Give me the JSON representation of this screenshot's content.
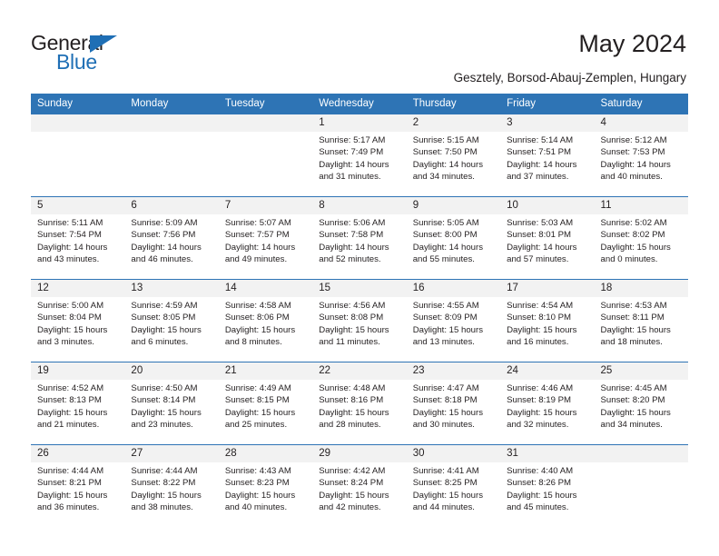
{
  "brand": {
    "name_part1": "General",
    "name_part2": "Blue",
    "accent_color": "#1f6fb5",
    "triangle_icon": "triangle-icon"
  },
  "header": {
    "title": "May 2024",
    "subtitle": "Gesztely, Borsod-Abauj-Zemplen, Hungary"
  },
  "calendar": {
    "header_bg": "#2e74b5",
    "daynum_bg": "#f2f2f2",
    "weekdays": [
      "Sunday",
      "Monday",
      "Tuesday",
      "Wednesday",
      "Thursday",
      "Friday",
      "Saturday"
    ],
    "weeks": [
      {
        "days": [
          {
            "num": "",
            "l1": "",
            "l2": "",
            "l3": "",
            "l4": ""
          },
          {
            "num": "",
            "l1": "",
            "l2": "",
            "l3": "",
            "l4": ""
          },
          {
            "num": "",
            "l1": "",
            "l2": "",
            "l3": "",
            "l4": ""
          },
          {
            "num": "1",
            "l1": "Sunrise: 5:17 AM",
            "l2": "Sunset: 7:49 PM",
            "l3": "Daylight: 14 hours",
            "l4": "and 31 minutes."
          },
          {
            "num": "2",
            "l1": "Sunrise: 5:15 AM",
            "l2": "Sunset: 7:50 PM",
            "l3": "Daylight: 14 hours",
            "l4": "and 34 minutes."
          },
          {
            "num": "3",
            "l1": "Sunrise: 5:14 AM",
            "l2": "Sunset: 7:51 PM",
            "l3": "Daylight: 14 hours",
            "l4": "and 37 minutes."
          },
          {
            "num": "4",
            "l1": "Sunrise: 5:12 AM",
            "l2": "Sunset: 7:53 PM",
            "l3": "Daylight: 14 hours",
            "l4": "and 40 minutes."
          }
        ]
      },
      {
        "days": [
          {
            "num": "5",
            "l1": "Sunrise: 5:11 AM",
            "l2": "Sunset: 7:54 PM",
            "l3": "Daylight: 14 hours",
            "l4": "and 43 minutes."
          },
          {
            "num": "6",
            "l1": "Sunrise: 5:09 AM",
            "l2": "Sunset: 7:56 PM",
            "l3": "Daylight: 14 hours",
            "l4": "and 46 minutes."
          },
          {
            "num": "7",
            "l1": "Sunrise: 5:07 AM",
            "l2": "Sunset: 7:57 PM",
            "l3": "Daylight: 14 hours",
            "l4": "and 49 minutes."
          },
          {
            "num": "8",
            "l1": "Sunrise: 5:06 AM",
            "l2": "Sunset: 7:58 PM",
            "l3": "Daylight: 14 hours",
            "l4": "and 52 minutes."
          },
          {
            "num": "9",
            "l1": "Sunrise: 5:05 AM",
            "l2": "Sunset: 8:00 PM",
            "l3": "Daylight: 14 hours",
            "l4": "and 55 minutes."
          },
          {
            "num": "10",
            "l1": "Sunrise: 5:03 AM",
            "l2": "Sunset: 8:01 PM",
            "l3": "Daylight: 14 hours",
            "l4": "and 57 minutes."
          },
          {
            "num": "11",
            "l1": "Sunrise: 5:02 AM",
            "l2": "Sunset: 8:02 PM",
            "l3": "Daylight: 15 hours",
            "l4": "and 0 minutes."
          }
        ]
      },
      {
        "days": [
          {
            "num": "12",
            "l1": "Sunrise: 5:00 AM",
            "l2": "Sunset: 8:04 PM",
            "l3": "Daylight: 15 hours",
            "l4": "and 3 minutes."
          },
          {
            "num": "13",
            "l1": "Sunrise: 4:59 AM",
            "l2": "Sunset: 8:05 PM",
            "l3": "Daylight: 15 hours",
            "l4": "and 6 minutes."
          },
          {
            "num": "14",
            "l1": "Sunrise: 4:58 AM",
            "l2": "Sunset: 8:06 PM",
            "l3": "Daylight: 15 hours",
            "l4": "and 8 minutes."
          },
          {
            "num": "15",
            "l1": "Sunrise: 4:56 AM",
            "l2": "Sunset: 8:08 PM",
            "l3": "Daylight: 15 hours",
            "l4": "and 11 minutes."
          },
          {
            "num": "16",
            "l1": "Sunrise: 4:55 AM",
            "l2": "Sunset: 8:09 PM",
            "l3": "Daylight: 15 hours",
            "l4": "and 13 minutes."
          },
          {
            "num": "17",
            "l1": "Sunrise: 4:54 AM",
            "l2": "Sunset: 8:10 PM",
            "l3": "Daylight: 15 hours",
            "l4": "and 16 minutes."
          },
          {
            "num": "18",
            "l1": "Sunrise: 4:53 AM",
            "l2": "Sunset: 8:11 PM",
            "l3": "Daylight: 15 hours",
            "l4": "and 18 minutes."
          }
        ]
      },
      {
        "days": [
          {
            "num": "19",
            "l1": "Sunrise: 4:52 AM",
            "l2": "Sunset: 8:13 PM",
            "l3": "Daylight: 15 hours",
            "l4": "and 21 minutes."
          },
          {
            "num": "20",
            "l1": "Sunrise: 4:50 AM",
            "l2": "Sunset: 8:14 PM",
            "l3": "Daylight: 15 hours",
            "l4": "and 23 minutes."
          },
          {
            "num": "21",
            "l1": "Sunrise: 4:49 AM",
            "l2": "Sunset: 8:15 PM",
            "l3": "Daylight: 15 hours",
            "l4": "and 25 minutes."
          },
          {
            "num": "22",
            "l1": "Sunrise: 4:48 AM",
            "l2": "Sunset: 8:16 PM",
            "l3": "Daylight: 15 hours",
            "l4": "and 28 minutes."
          },
          {
            "num": "23",
            "l1": "Sunrise: 4:47 AM",
            "l2": "Sunset: 8:18 PM",
            "l3": "Daylight: 15 hours",
            "l4": "and 30 minutes."
          },
          {
            "num": "24",
            "l1": "Sunrise: 4:46 AM",
            "l2": "Sunset: 8:19 PM",
            "l3": "Daylight: 15 hours",
            "l4": "and 32 minutes."
          },
          {
            "num": "25",
            "l1": "Sunrise: 4:45 AM",
            "l2": "Sunset: 8:20 PM",
            "l3": "Daylight: 15 hours",
            "l4": "and 34 minutes."
          }
        ]
      },
      {
        "days": [
          {
            "num": "26",
            "l1": "Sunrise: 4:44 AM",
            "l2": "Sunset: 8:21 PM",
            "l3": "Daylight: 15 hours",
            "l4": "and 36 minutes."
          },
          {
            "num": "27",
            "l1": "Sunrise: 4:44 AM",
            "l2": "Sunset: 8:22 PM",
            "l3": "Daylight: 15 hours",
            "l4": "and 38 minutes."
          },
          {
            "num": "28",
            "l1": "Sunrise: 4:43 AM",
            "l2": "Sunset: 8:23 PM",
            "l3": "Daylight: 15 hours",
            "l4": "and 40 minutes."
          },
          {
            "num": "29",
            "l1": "Sunrise: 4:42 AM",
            "l2": "Sunset: 8:24 PM",
            "l3": "Daylight: 15 hours",
            "l4": "and 42 minutes."
          },
          {
            "num": "30",
            "l1": "Sunrise: 4:41 AM",
            "l2": "Sunset: 8:25 PM",
            "l3": "Daylight: 15 hours",
            "l4": "and 44 minutes."
          },
          {
            "num": "31",
            "l1": "Sunrise: 4:40 AM",
            "l2": "Sunset: 8:26 PM",
            "l3": "Daylight: 15 hours",
            "l4": "and 45 minutes."
          },
          {
            "num": "",
            "l1": "",
            "l2": "",
            "l3": "",
            "l4": ""
          }
        ]
      }
    ]
  }
}
